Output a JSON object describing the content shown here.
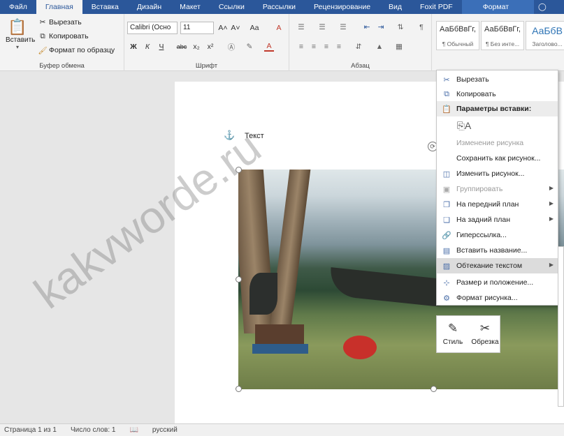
{
  "tabs": [
    "Файл",
    "Главная",
    "Вставка",
    "Дизайн",
    "Макет",
    "Ссылки",
    "Рассылки",
    "Рецензирование",
    "Вид",
    "Foxit PDF",
    "Формат"
  ],
  "clipboard": {
    "paste": "Вставить",
    "cut": "Вырезать",
    "copy": "Копировать",
    "format_painter": "Формат по образцу",
    "label": "Буфер обмена"
  },
  "font": {
    "name": "Calibri (Осно",
    "size": "11",
    "label": "Шрифт",
    "bold": "Ж",
    "italic": "К",
    "underline": "Ч",
    "strike": "abc",
    "sub": "x₂",
    "sup": "x²",
    "grow": "A˄",
    "shrink": "A˅",
    "case": "Aa",
    "clear": "A"
  },
  "paragraph": {
    "label": "Абзац"
  },
  "styles": [
    {
      "sample": "АаБбВвГг,",
      "name": "¶ Обычный"
    },
    {
      "sample": "АаБбВвГг,",
      "name": "¶ Без инте..."
    },
    {
      "sample": "АаБбВ",
      "name": "Заголово..."
    }
  ],
  "help_icon": "lightbulb-icon",
  "document": {
    "text": "Текст"
  },
  "context_menu": {
    "items": [
      {
        "label": "Вырезать",
        "icon": "scissors-icon",
        "disabled": false
      },
      {
        "label": "Копировать",
        "icon": "copy-icon",
        "disabled": false
      },
      {
        "label": "Параметры вставки:",
        "icon": "paste-icon",
        "disabled": false
      },
      {
        "label": "Изменение рисунка",
        "icon": "",
        "disabled": true
      },
      {
        "label": "Сохранить как рисунок...",
        "icon": "",
        "disabled": false
      },
      {
        "label": "Изменить рисунок...",
        "icon": "change-picture-icon",
        "disabled": false
      },
      {
        "label": "Группировать",
        "icon": "group-icon",
        "disabled": true
      },
      {
        "label": "На передний план",
        "icon": "bring-forward-icon",
        "disabled": false
      },
      {
        "label": "На задний план",
        "icon": "send-backward-icon",
        "disabled": false
      },
      {
        "label": "Гиперссылка...",
        "icon": "hyperlink-icon",
        "disabled": false
      },
      {
        "label": "Вставить название...",
        "icon": "caption-icon",
        "disabled": false
      },
      {
        "label": "Обтекание текстом",
        "icon": "wrap-text-icon",
        "disabled": false
      },
      {
        "label": "Размер и положение...",
        "icon": "size-icon",
        "disabled": false
      },
      {
        "label": "Формат рисунка...",
        "icon": "format-picture-icon",
        "disabled": false
      }
    ]
  },
  "mini_toolbar": {
    "style": "Стиль",
    "crop": "Обрезка"
  },
  "status": {
    "page": "Страница 1 из 1",
    "words": "Число слов: 1",
    "lang": "русский"
  },
  "watermark": "kakvworde.ru"
}
